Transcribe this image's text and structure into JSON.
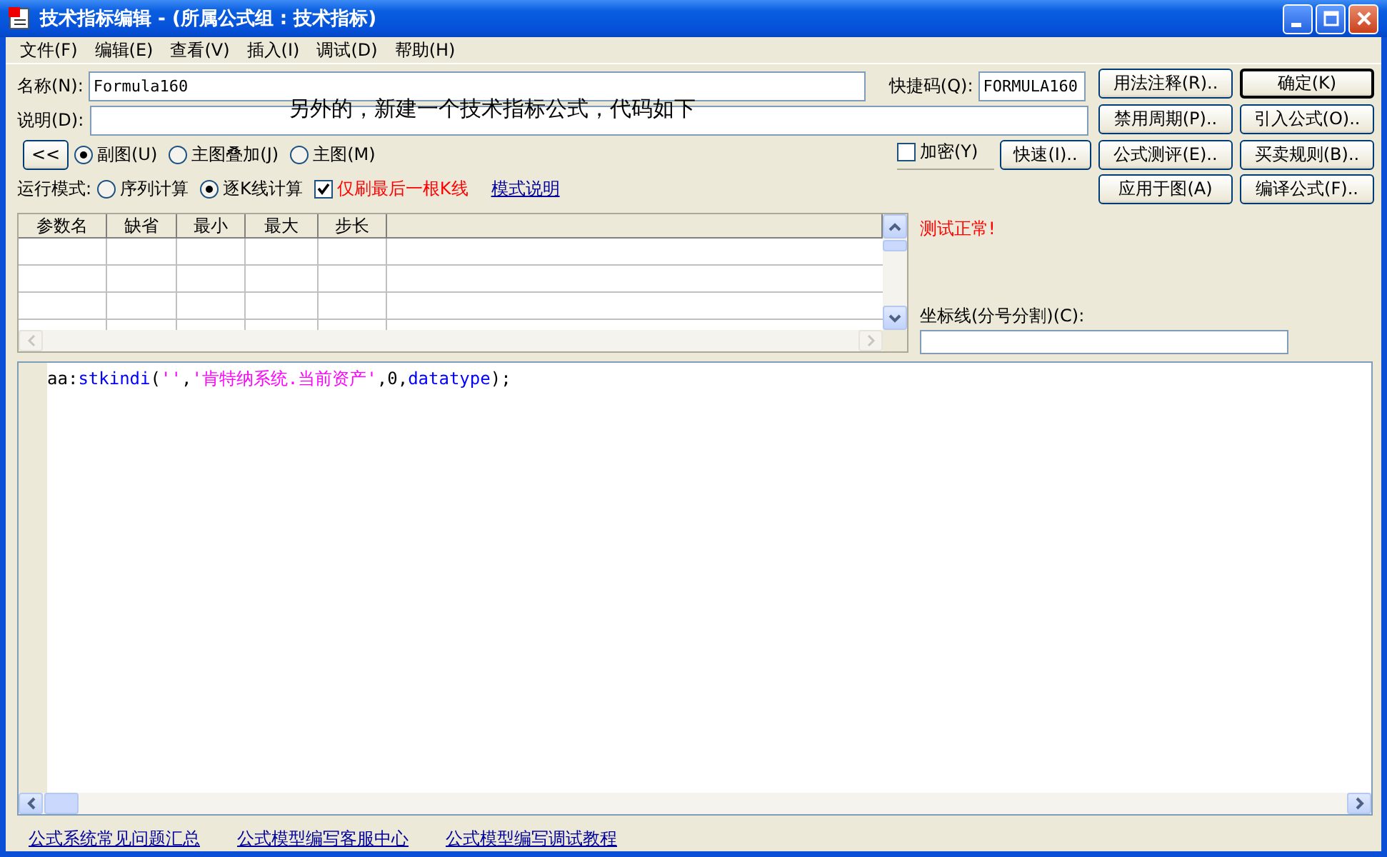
{
  "window": {
    "title": "技术指标编辑 - (所属公式组 : 技术指标)"
  },
  "menu": [
    {
      "label": "文件(F)"
    },
    {
      "label": "编辑(E)"
    },
    {
      "label": "查看(V)"
    },
    {
      "label": "插入(I)"
    },
    {
      "label": "调试(D)"
    },
    {
      "label": "帮助(H)"
    }
  ],
  "form": {
    "name_label": "名称(N):",
    "name_value": "Formula160",
    "shortcut_label": "快捷码(Q):",
    "shortcut_value": "FORMULA160",
    "desc_label": "说明(D):",
    "collapse_button": "<<"
  },
  "annotation": "另外的，新建一个技术指标公式，代码如下",
  "chart_type_options": [
    {
      "label": "副图(U)",
      "selected": true
    },
    {
      "label": "主图叠加(J)",
      "selected": false
    },
    {
      "label": "主图(M)",
      "selected": false
    }
  ],
  "encrypt": {
    "label": "加密(Y)",
    "checked": false
  },
  "quick_button": "快速(I)..",
  "run_mode": {
    "label": "运行模式:",
    "options": [
      {
        "label": "序列计算",
        "selected": false
      },
      {
        "label": "逐K线计算",
        "selected": true
      }
    ],
    "refresh_last": {
      "label": "仅刷最后一根K线",
      "checked": true
    },
    "help_link": "模式说明"
  },
  "buttons": [
    {
      "label": "用法注释(R)..",
      "default": false
    },
    {
      "label": "确定(K)",
      "default": true
    },
    {
      "label": "禁用周期(P)..",
      "default": false
    },
    {
      "label": "引入公式(O)..",
      "default": false
    },
    {
      "label": "公式测评(E)..",
      "default": false
    },
    {
      "label": "买卖规则(B)..",
      "default": false
    },
    {
      "label": "应用于图(A)",
      "default": false
    },
    {
      "label": "编译公式(F)..",
      "default": false
    }
  ],
  "params_table": {
    "columns": [
      "参数名",
      "缺省",
      "最小",
      "最大",
      "步长"
    ]
  },
  "test_status": "测试正常!",
  "axis_lines": {
    "label": "坐标线(分号分割)(C):"
  },
  "code": {
    "lines": [
      [
        {
          "kind": "plain",
          "text": "aa:"
        },
        {
          "kind": "function",
          "text": "stkindi"
        },
        {
          "kind": "plain",
          "text": "("
        },
        {
          "kind": "string",
          "text": "''"
        },
        {
          "kind": "plain",
          "text": ","
        },
        {
          "kind": "string",
          "text": "'肯特纳系统.当前资产'"
        },
        {
          "kind": "plain",
          "text": ",0,"
        },
        {
          "kind": "function",
          "text": "datatype"
        },
        {
          "kind": "plain",
          "text": ");"
        }
      ]
    ]
  },
  "footer_links": [
    "公式系统常见问题汇总",
    "公式模型编写客服中心",
    "公式模型编写调试教程"
  ]
}
